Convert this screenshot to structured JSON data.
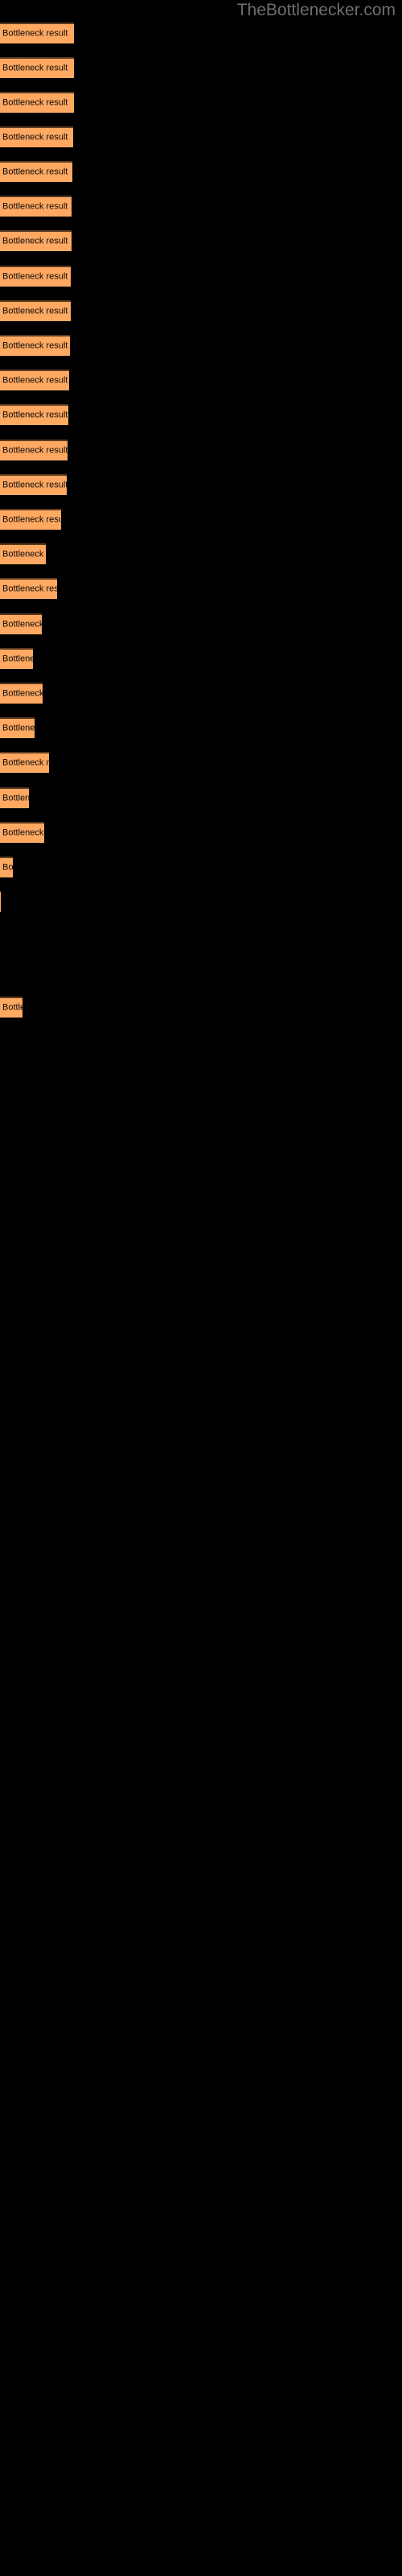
{
  "site": {
    "title": "TheBottlenecker.com"
  },
  "colors": {
    "background": "#000000",
    "bar_fill": "#ffa861",
    "bar_edge": "#5a3a20",
    "label_text": "#0a0a0a",
    "title_text": "#6e6e6e"
  },
  "chart_data": {
    "type": "bar",
    "orientation": "horizontal",
    "title": "",
    "subtitle": "",
    "xlabel": "",
    "ylabel": "",
    "grid": false,
    "legend": null,
    "bar_label_text": "Bottleneck result",
    "xlim": [
      0,
      500
    ],
    "categories": [
      "Bottleneck result",
      "Bottleneck result",
      "Bottleneck result",
      "Bottleneck result",
      "Bottleneck result",
      "Bottleneck result",
      "Bottleneck result",
      "Bottleneck result",
      "Bottleneck result",
      "Bottleneck result",
      "Bottleneck result",
      "Bottleneck result",
      "Bottleneck result",
      "Bottleneck result",
      "Bottleneck resu",
      "Bottleneck",
      "Bottleneck res",
      "Bottlenec",
      "Bottler",
      "Bottleneck",
      "Bottlene",
      "Bottleneck r",
      "Bottle",
      "Bottlenec",
      "B",
      "",
      "Bo"
    ],
    "values": [
      92,
      92,
      92,
      91,
      90,
      89,
      89,
      88,
      88,
      87,
      86,
      85,
      84,
      83,
      76,
      57,
      71,
      52,
      41,
      53,
      43,
      61,
      36,
      55,
      16,
      1,
      28
    ],
    "bars": [
      {
        "y": 28,
        "width": 92,
        "label": "Bottleneck result"
      },
      {
        "y": 71,
        "width": 92,
        "label": "Bottleneck result"
      },
      {
        "y": 114,
        "width": 92,
        "label": "Bottleneck result"
      },
      {
        "y": 157,
        "width": 91,
        "label": "Bottleneck result"
      },
      {
        "y": 200,
        "width": 90,
        "label": "Bottleneck result"
      },
      {
        "y": 243,
        "width": 89,
        "label": "Bottleneck result"
      },
      {
        "y": 286,
        "width": 89,
        "label": "Bottleneck result"
      },
      {
        "y": 330,
        "width": 88,
        "label": "Bottleneck result"
      },
      {
        "y": 373,
        "width": 88,
        "label": "Bottleneck result"
      },
      {
        "y": 416,
        "width": 87,
        "label": "Bottleneck result"
      },
      {
        "y": 459,
        "width": 86,
        "label": "Bottleneck result"
      },
      {
        "y": 502,
        "width": 85,
        "label": "Bottleneck result"
      },
      {
        "y": 546,
        "width": 84,
        "label": "Bottleneck result"
      },
      {
        "y": 589,
        "width": 83,
        "label": "Bottleneck result"
      },
      {
        "y": 632,
        "width": 76,
        "label": "Bottleneck resu"
      },
      {
        "y": 675,
        "width": 57,
        "label": "Bottleneck"
      },
      {
        "y": 718,
        "width": 71,
        "label": "Bottleneck res"
      },
      {
        "y": 762,
        "width": 52,
        "label": "Bottlenec"
      },
      {
        "y": 805,
        "width": 41,
        "label": "Bottler"
      },
      {
        "y": 848,
        "width": 53,
        "label": "Bottleneck"
      },
      {
        "y": 891,
        "width": 43,
        "label": "Bottlene"
      },
      {
        "y": 934,
        "width": 61,
        "label": "Bottleneck r"
      },
      {
        "y": 978,
        "width": 36,
        "label": "Bottle"
      },
      {
        "y": 1021,
        "width": 55,
        "label": "Bottlenec"
      },
      {
        "y": 1064,
        "width": 16,
        "label": "B"
      },
      {
        "y": 1107,
        "width": 1,
        "label": ""
      },
      {
        "y": 1238,
        "width": 28,
        "label": "Bo"
      }
    ]
  }
}
